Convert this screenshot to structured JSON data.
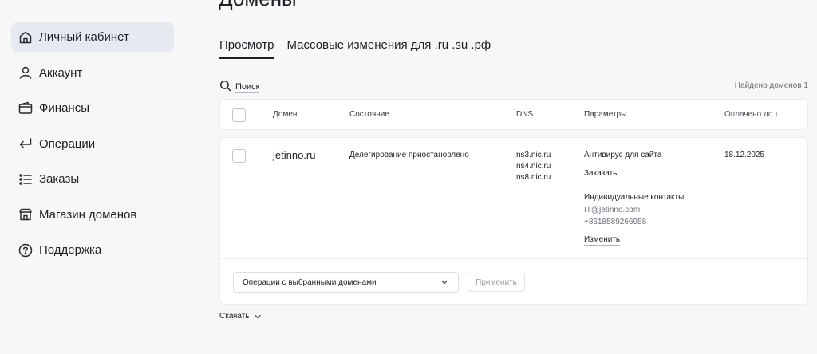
{
  "page": {
    "title": "Домены"
  },
  "sidebar": {
    "items": [
      {
        "label": "Личный кабинет",
        "icon": "home-icon",
        "active": true
      },
      {
        "label": "Аккаунт",
        "icon": "user-icon"
      },
      {
        "label": "Финансы",
        "icon": "wallet-icon"
      },
      {
        "label": "Операции",
        "icon": "enter-arrow-icon"
      },
      {
        "label": "Заказы",
        "icon": "list-icon"
      },
      {
        "label": "Магазин доменов",
        "icon": "shop-icon"
      },
      {
        "label": "Поддержка",
        "icon": "help-icon"
      }
    ]
  },
  "tabs": [
    {
      "label": "Просмотр",
      "active": true
    },
    {
      "label": "Массовые изменения для .ru .su .рф"
    }
  ],
  "search": {
    "label": "Поиск"
  },
  "found_text": "Найдено доменов 1",
  "table": {
    "columns": {
      "domain": "Домен",
      "status": "Состояние",
      "dns": "DNS",
      "params": "Параметры",
      "paid": "Оплачено до ↓"
    },
    "rows": [
      {
        "domain": "jetinno.ru",
        "status": "Делегирование приостановлено",
        "dns": [
          "ns3.nic.ru",
          "ns4.nic.ru",
          "ns8.nic.ru"
        ],
        "antivirus": "Антивирус для сайта",
        "order_link": "Заказать",
        "contacts_title": "Индивидуальные контакты",
        "email": "IT@jetinno.com",
        "phone": "+8618589266958",
        "edit_link": "Изменить",
        "paid_until": "18.12.2025"
      }
    ]
  },
  "actions": {
    "select_placeholder": "Операции с выбранными доменами",
    "apply_label": "Применить"
  },
  "download_label": "Скачать"
}
